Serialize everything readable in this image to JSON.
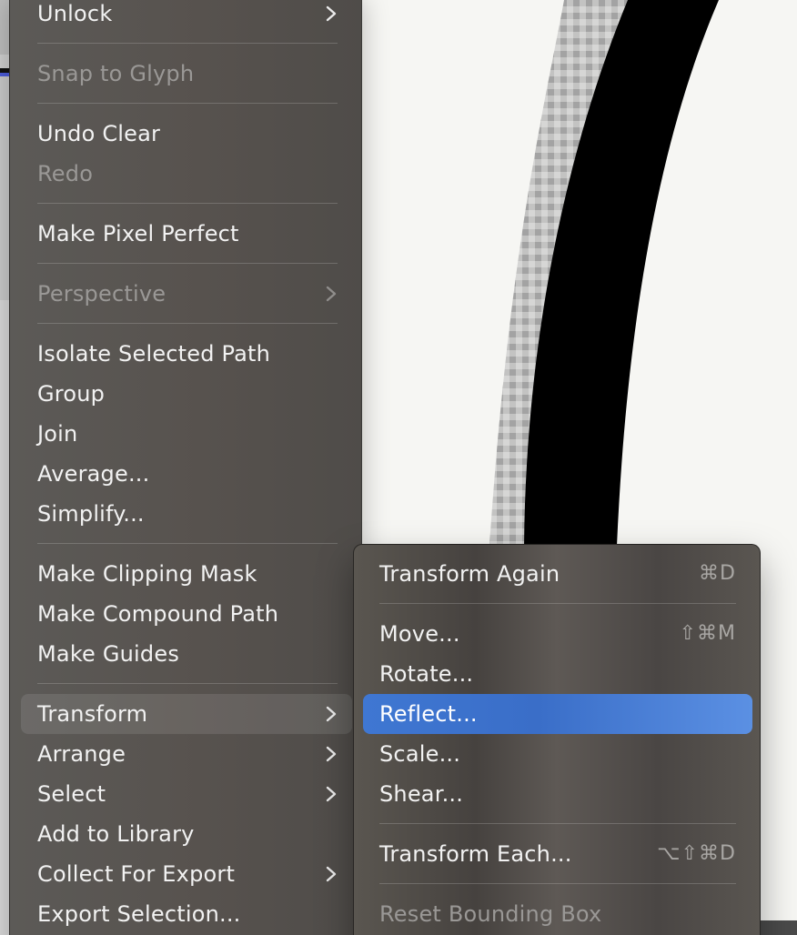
{
  "main_menu": {
    "items": [
      {
        "label": "Unlock",
        "enabled": true,
        "submenu": true
      },
      {
        "label": "Snap to Glyph",
        "enabled": false,
        "submenu": false
      },
      {
        "label": "Undo Clear",
        "enabled": true,
        "submenu": false
      },
      {
        "label": "Redo",
        "enabled": false,
        "submenu": false
      },
      {
        "label": "Make Pixel Perfect",
        "enabled": true,
        "submenu": false
      },
      {
        "label": "Perspective",
        "enabled": false,
        "submenu": true
      },
      {
        "label": "Isolate Selected Path",
        "enabled": true,
        "submenu": false
      },
      {
        "label": "Group",
        "enabled": true,
        "submenu": false
      },
      {
        "label": "Join",
        "enabled": true,
        "submenu": false
      },
      {
        "label": "Average...",
        "enabled": true,
        "submenu": false
      },
      {
        "label": "Simplify...",
        "enabled": true,
        "submenu": false
      },
      {
        "label": "Make Clipping Mask",
        "enabled": true,
        "submenu": false
      },
      {
        "label": "Make Compound Path",
        "enabled": true,
        "submenu": false
      },
      {
        "label": "Make Guides",
        "enabled": true,
        "submenu": false
      },
      {
        "label": "Transform",
        "enabled": true,
        "submenu": true,
        "active": true
      },
      {
        "label": "Arrange",
        "enabled": true,
        "submenu": true
      },
      {
        "label": "Select",
        "enabled": true,
        "submenu": true
      },
      {
        "label": "Add to Library",
        "enabled": true,
        "submenu": false
      },
      {
        "label": "Collect For Export",
        "enabled": true,
        "submenu": true
      },
      {
        "label": "Export Selection...",
        "enabled": true,
        "submenu": false
      }
    ]
  },
  "transform_submenu": {
    "items": [
      {
        "label": "Transform Again",
        "shortcut": "⌘D",
        "enabled": true
      },
      {
        "label": "Move...",
        "shortcut": "⇧⌘M",
        "enabled": true
      },
      {
        "label": "Rotate...",
        "shortcut": "",
        "enabled": true
      },
      {
        "label": "Reflect...",
        "shortcut": "",
        "enabled": true,
        "selected": true
      },
      {
        "label": "Scale...",
        "shortcut": "",
        "enabled": true
      },
      {
        "label": "Shear...",
        "shortcut": "",
        "enabled": true
      },
      {
        "label": "Transform Each...",
        "shortcut": "⌥⇧⌘D",
        "enabled": true
      },
      {
        "label": "Reset Bounding Box",
        "shortcut": "",
        "enabled": false
      }
    ]
  },
  "icons": {
    "submenu_arrow": "chevron-right-icon"
  },
  "colors": {
    "menu_bg": "#57524e",
    "selection": "#3f77d2",
    "disabled_text": "#9a9896"
  }
}
